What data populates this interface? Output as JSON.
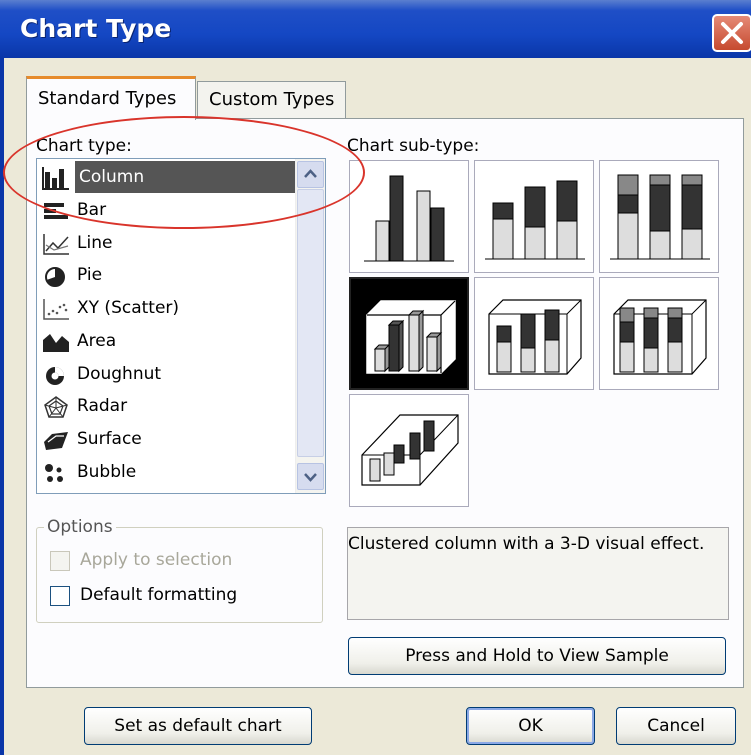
{
  "window": {
    "title": "Chart Type"
  },
  "tabs": [
    {
      "label": "Standard Types",
      "active": true
    },
    {
      "label": "Custom Types",
      "active": false
    }
  ],
  "chart_type": {
    "label": "Chart type:",
    "items": [
      {
        "label": "Column",
        "icon": "column-chart-icon",
        "selected": true
      },
      {
        "label": "Bar",
        "icon": "bar-chart-icon"
      },
      {
        "label": "Line",
        "icon": "line-chart-icon"
      },
      {
        "label": "Pie",
        "icon": "pie-chart-icon"
      },
      {
        "label": "XY (Scatter)",
        "icon": "scatter-chart-icon"
      },
      {
        "label": "Area",
        "icon": "area-chart-icon"
      },
      {
        "label": "Doughnut",
        "icon": "doughnut-chart-icon"
      },
      {
        "label": "Radar",
        "icon": "radar-chart-icon"
      },
      {
        "label": "Surface",
        "icon": "surface-chart-icon"
      },
      {
        "label": "Bubble",
        "icon": "bubble-chart-icon"
      }
    ]
  },
  "subtype": {
    "label": "Chart sub-type:",
    "items": [
      {
        "name": "clustered-column",
        "selected": false
      },
      {
        "name": "stacked-column",
        "selected": false
      },
      {
        "name": "100-stacked-column",
        "selected": false
      },
      {
        "name": "3d-clustered-column",
        "selected": true
      },
      {
        "name": "3d-stacked-column",
        "selected": false
      },
      {
        "name": "3d-100-stacked-column",
        "selected": false
      },
      {
        "name": "3d-column",
        "selected": false
      }
    ]
  },
  "options": {
    "title": "Options",
    "apply_to_selection": {
      "label": "Apply to selection",
      "checked": false,
      "disabled": true
    },
    "default_formatting": {
      "label": "Default formatting",
      "checked": false,
      "disabled": false
    }
  },
  "description": "Clustered column with a 3-D visual effect.",
  "buttons": {
    "press_hold": "Press and Hold to View Sample",
    "set_default": "Set as default chart",
    "ok": "OK",
    "cancel": "Cancel"
  },
  "colors": {
    "title_bar": "#1447c3",
    "selection": "#555555",
    "annotation": "#d9342b"
  }
}
